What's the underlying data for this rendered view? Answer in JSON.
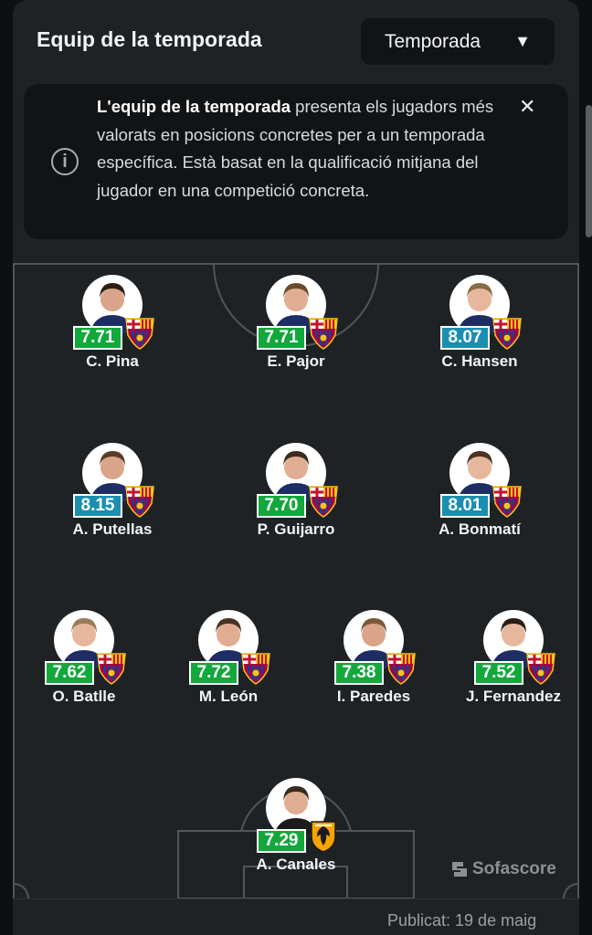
{
  "header": {
    "title": "Equip de la temporada",
    "season_select": {
      "value": "Temporada",
      "icon": "chevron-down-icon"
    }
  },
  "info": {
    "bold": "L'equip de la temporada",
    "text": " presenta els jugadors més valorats en posicions concretes per a un temporada específica. Està basat en la qualificació mitjana del jugador en una competició concreta.",
    "icon": "info-icon",
    "close_icon": "close-icon"
  },
  "colors": {
    "rating_green": "#12a83c",
    "rating_blue": "#1a8fb0",
    "background": "#1f2225"
  },
  "players": [
    {
      "name": "C. Pina",
      "rating": "7.71",
      "rating_color": "green",
      "team": "barcelona"
    },
    {
      "name": "E. Pajor",
      "rating": "7.71",
      "rating_color": "green",
      "team": "barcelona"
    },
    {
      "name": "C. Hansen",
      "rating": "8.07",
      "rating_color": "blue",
      "team": "barcelona"
    },
    {
      "name": "A. Putellas",
      "rating": "8.15",
      "rating_color": "blue",
      "team": "barcelona"
    },
    {
      "name": "P. Guijarro",
      "rating": "7.70",
      "rating_color": "green",
      "team": "barcelona"
    },
    {
      "name": "A. Bonmatí",
      "rating": "8.01",
      "rating_color": "blue",
      "team": "barcelona"
    },
    {
      "name": "O. Batlle",
      "rating": "7.62",
      "rating_color": "green",
      "team": "barcelona"
    },
    {
      "name": "M. León",
      "rating": "7.72",
      "rating_color": "green",
      "team": "barcelona"
    },
    {
      "name": "I. Paredes",
      "rating": "7.38",
      "rating_color": "green",
      "team": "barcelona"
    },
    {
      "name": "J. Fernandez",
      "rating": "7.52",
      "rating_color": "green",
      "team": "barcelona"
    },
    {
      "name": "A. Canales",
      "rating": "7.29",
      "rating_color": "green",
      "team": "valencia"
    }
  ],
  "watermark": "Sofascore",
  "footer": {
    "published": "Publicat: 19 de maig"
  }
}
